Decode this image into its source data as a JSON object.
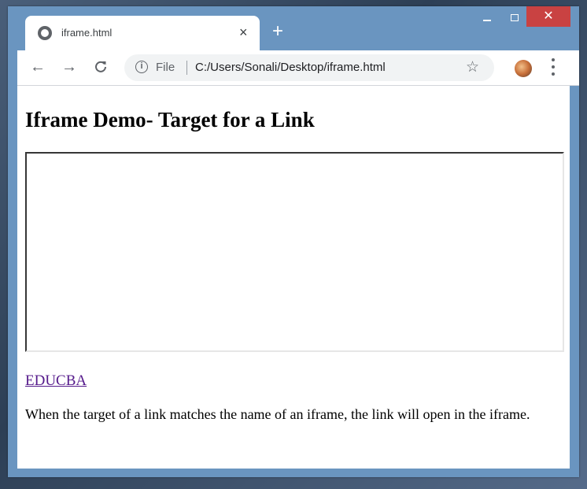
{
  "browser": {
    "tab_title": "iframe.html",
    "tab_close": "×",
    "new_tab": "+",
    "caption_close": "✕",
    "nav_back": "←",
    "nav_forward": "→",
    "nav_reload": "C",
    "info_glyph": "i",
    "scheme_label": "File",
    "url": "C:/Users/Sonali/Desktop/iframe.html",
    "star": "☆",
    "icons": [
      "globe-icon",
      "back-arrow-icon",
      "forward-arrow-icon",
      "reload-icon",
      "info-icon",
      "star-icon",
      "kebab-menu-icon"
    ]
  },
  "page": {
    "heading": "Iframe Demo- Target for a Link",
    "link_text": "EDUCBA",
    "paragraph": "When the target of a link matches the name of an iframe, the link will open in the iframe."
  },
  "colors": {
    "window_frame": "#6a95c0",
    "close_button": "#c94242",
    "visited_link": "#551a8b"
  }
}
